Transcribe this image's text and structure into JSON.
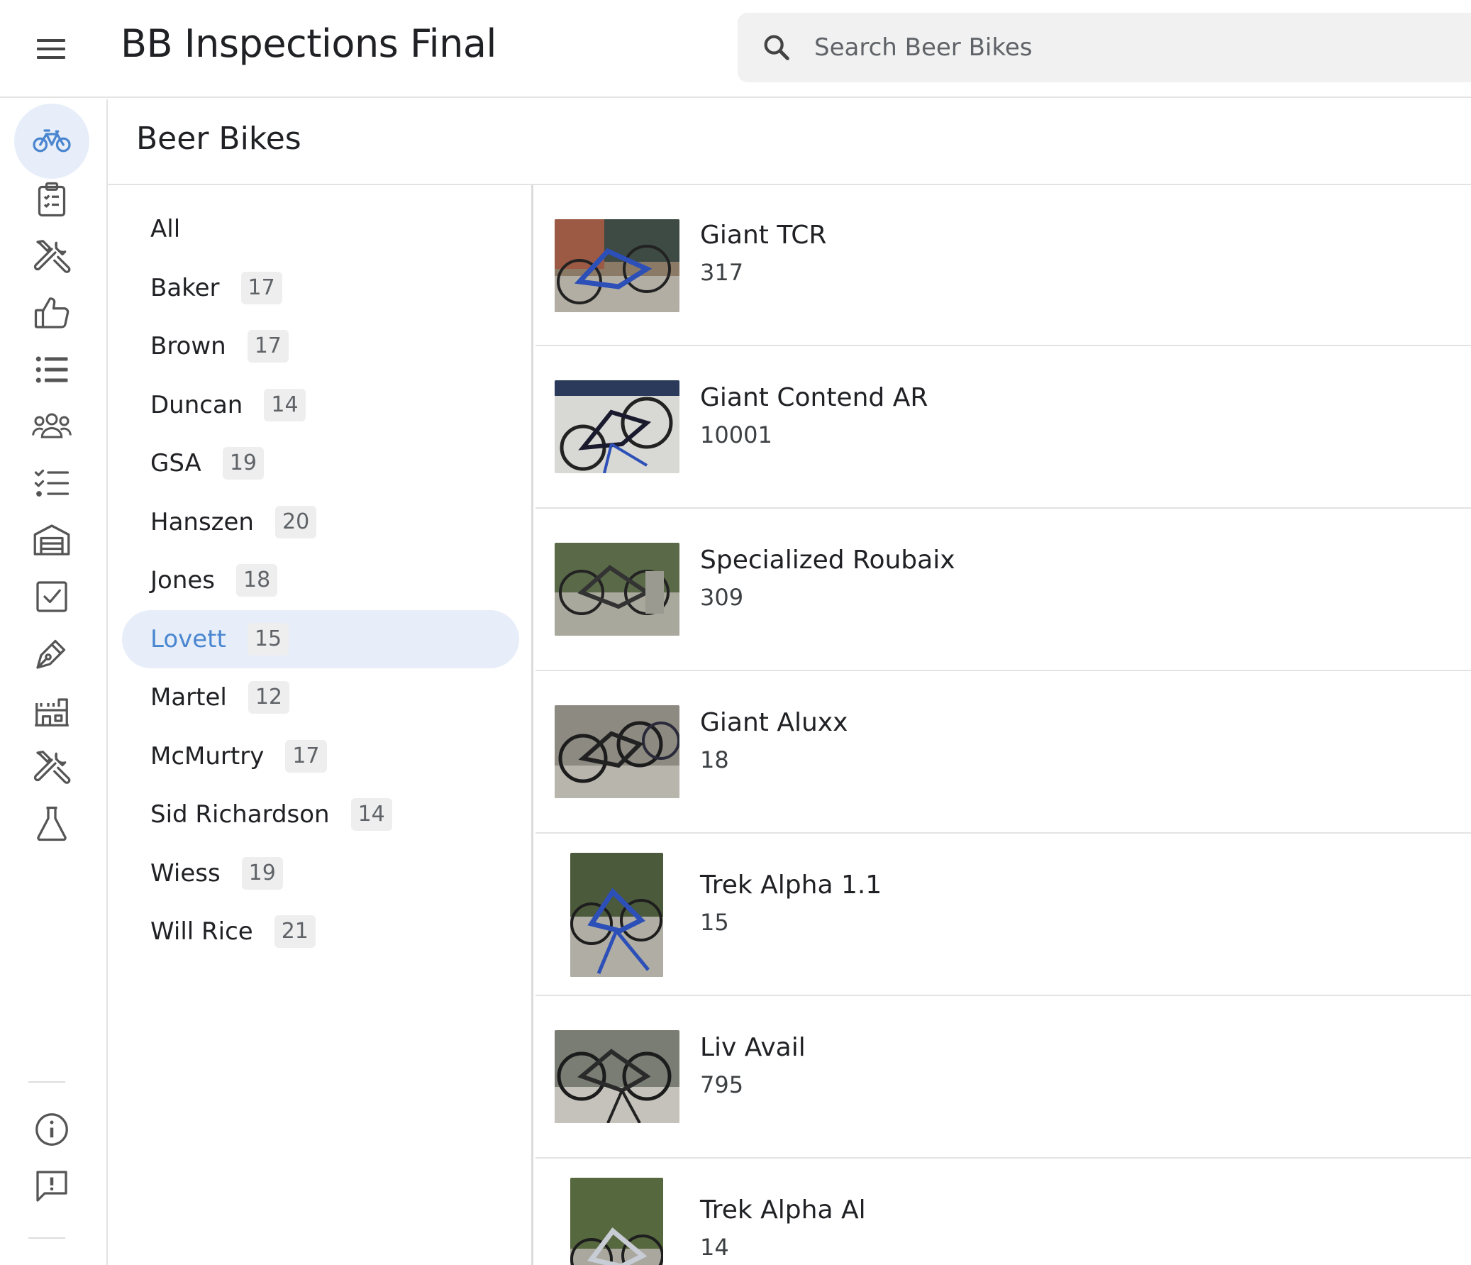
{
  "header": {
    "title": "BB Inspections Final",
    "search_placeholder": "Search Beer Bikes"
  },
  "rail": {
    "items": [
      {
        "icon": "bicycle-icon",
        "active": true
      },
      {
        "icon": "clipboard-checklist-icon"
      },
      {
        "icon": "tools-icon"
      },
      {
        "icon": "thumbs-up-icon"
      },
      {
        "icon": "bulleted-list-icon"
      },
      {
        "icon": "group-icon"
      },
      {
        "icon": "checklist-icon"
      },
      {
        "icon": "garage-icon"
      },
      {
        "icon": "checkbox-icon"
      },
      {
        "icon": "pen-icon"
      },
      {
        "icon": "building-icon"
      },
      {
        "icon": "tools-icon"
      },
      {
        "icon": "flask-icon"
      },
      {
        "icon": "info-icon"
      },
      {
        "icon": "feedback-icon"
      }
    ]
  },
  "page": {
    "title": "Beer Bikes"
  },
  "filters": [
    {
      "label": "All",
      "count": ""
    },
    {
      "label": "Baker",
      "count": "17"
    },
    {
      "label": "Brown",
      "count": "17"
    },
    {
      "label": "Duncan",
      "count": "14"
    },
    {
      "label": "GSA",
      "count": "19"
    },
    {
      "label": "Hanszen",
      "count": "20"
    },
    {
      "label": "Jones",
      "count": "18"
    },
    {
      "label": "Lovett",
      "count": "15",
      "selected": true
    },
    {
      "label": "Martel",
      "count": "12"
    },
    {
      "label": "McMurtry",
      "count": "17"
    },
    {
      "label": "Sid Richardson",
      "count": "14"
    },
    {
      "label": "Wiess",
      "count": "19"
    },
    {
      "label": "Will Rice",
      "count": "21"
    }
  ],
  "bikes": [
    {
      "name": "Giant TCR",
      "number": "317"
    },
    {
      "name": "Giant Contend AR",
      "number": "10001"
    },
    {
      "name": "Specialized Roubaix",
      "number": "309"
    },
    {
      "name": "Giant Aluxx",
      "number": "18"
    },
    {
      "name": "Trek Alpha 1.1",
      "number": "15"
    },
    {
      "name": "Liv Avail",
      "number": "795"
    },
    {
      "name": "Trek Alpha Al",
      "number": "14"
    }
  ],
  "colors": {
    "accent": "#4a86d0",
    "active_bg": "#e7eef9",
    "divider": "#e3e3e3",
    "search_bg": "#f1f1f1"
  }
}
